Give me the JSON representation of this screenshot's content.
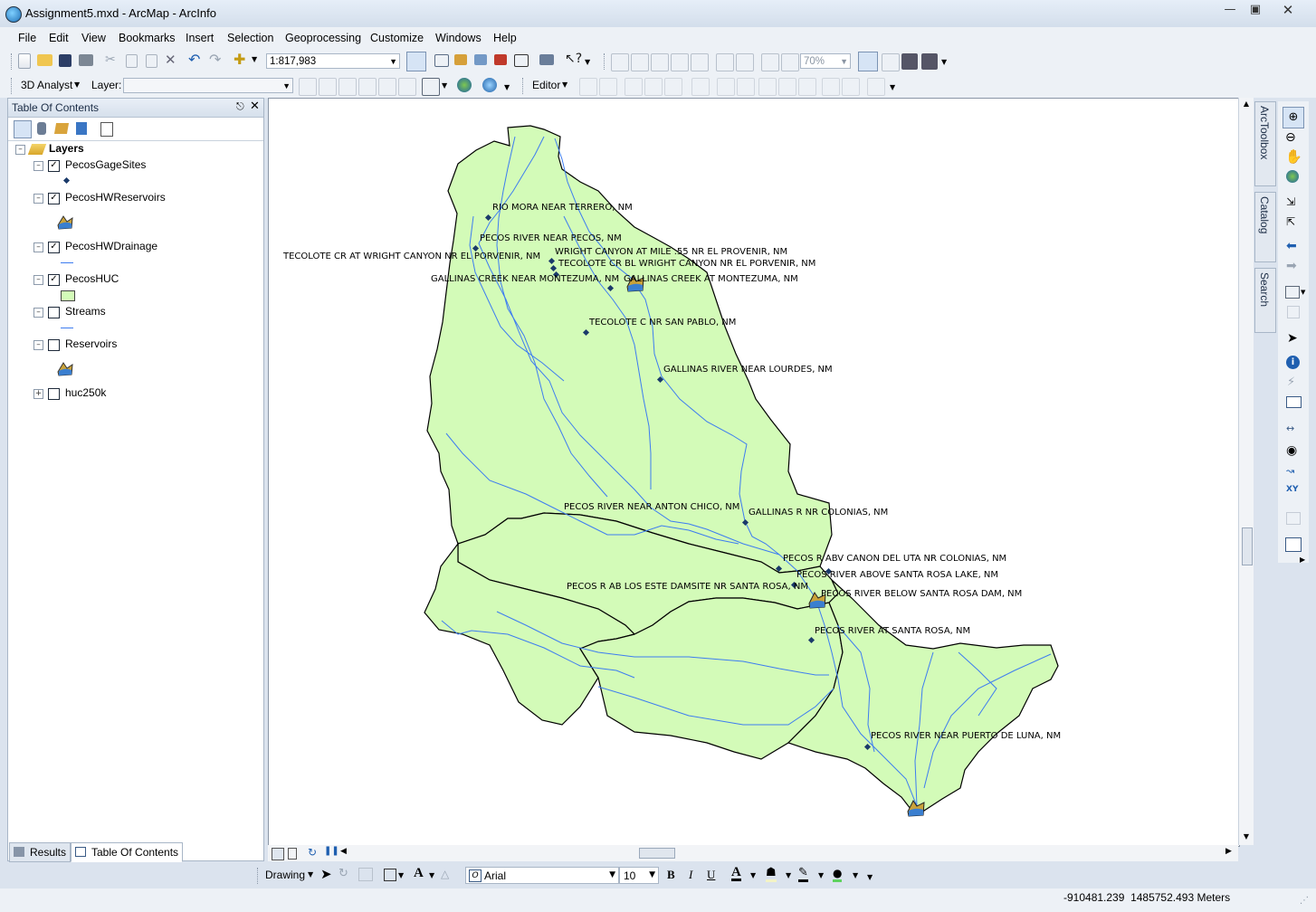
{
  "window": {
    "title": "Assignment5.mxd - ArcMap - ArcInfo"
  },
  "menu": [
    "File",
    "Edit",
    "View",
    "Bookmarks",
    "Insert",
    "Selection",
    "Geoprocessing",
    "Customize",
    "Windows",
    "Help"
  ],
  "standard_toolbar": {
    "scale": "1:817,983",
    "zoom": "70%"
  },
  "toolbar2": {
    "analyst_label": "3D Analyst",
    "layer_label": "Layer:",
    "layer_value": "",
    "editor_label": "Editor"
  },
  "toc": {
    "title": "Table Of Contents",
    "root": "Layers",
    "layers": [
      {
        "name": "PecosGageSites",
        "checked": true,
        "expanded": true,
        "symbol": "point"
      },
      {
        "name": "PecosHWReservoirs",
        "checked": true,
        "expanded": true,
        "symbol": "reservoir"
      },
      {
        "name": "PecosHWDrainage",
        "checked": true,
        "expanded": true,
        "symbol": "line"
      },
      {
        "name": "PecosHUC",
        "checked": true,
        "expanded": true,
        "symbol": "polygon"
      },
      {
        "name": "Streams",
        "checked": false,
        "expanded": true,
        "symbol": "line"
      },
      {
        "name": "Reservoirs",
        "checked": false,
        "expanded": true,
        "symbol": "reservoir"
      },
      {
        "name": "huc250k",
        "checked": false,
        "expanded": false,
        "symbol": "none"
      }
    ],
    "tabs": [
      "Results",
      "Table Of Contents"
    ]
  },
  "map": {
    "gage_labels": [
      "RIO MORA NEAR TERRERO, NM",
      "PECOS RIVER NEAR PECOS, NM",
      "TECOLOTE CR AT WRIGHT CANYON NR EL PORVENIR, NM",
      "WRIGHT CANYON AT MILE .55 NR EL PROVENIR, NM",
      "TECOLOTE CR BL WRIGHT CANYON NR EL PORVENIR, NM",
      "GALLINAS CREEK NEAR MONTEZUMA, NM",
      "GALLINAS CREEK AT MONTEZUMA, NM",
      "TECOLOTE C NR SAN PABLO, NM",
      "GALLINAS RIVER NEAR LOURDES, NM",
      "PECOS RIVER NEAR ANTON CHICO, NM",
      "GALLINAS R NR COLONIAS, NM",
      "PECOS R ABV CANON DEL UTA NR COLONIAS, NM",
      "PECOS RIVER ABOVE SANTA ROSA LAKE, NM",
      "PECOS R AB LOS ESTE DAMSITE NR SANTA ROSA, NM",
      "PECOS RIVER BELOW SANTA ROSA DAM, NM",
      "PECOS RIVER AT SANTA ROSA, NM",
      "PECOS RIVER NEAR PUERTO DE LUNA, NM"
    ],
    "colors": {
      "huc_fill": "#d3fbb8",
      "stream": "#3d7cf0",
      "boundary": "#000000",
      "gage": "#1a3a6a"
    }
  },
  "right_dock": [
    "ArcToolbox",
    "Catalog",
    "Search"
  ],
  "drawing_toolbar": {
    "label": "Drawing",
    "font": "Arial",
    "size": "10",
    "bold": "B",
    "italic": "I",
    "underline": "U",
    "text_tool": "A"
  },
  "status": {
    "coords": "-910481.239  1485752.493 Meters"
  }
}
